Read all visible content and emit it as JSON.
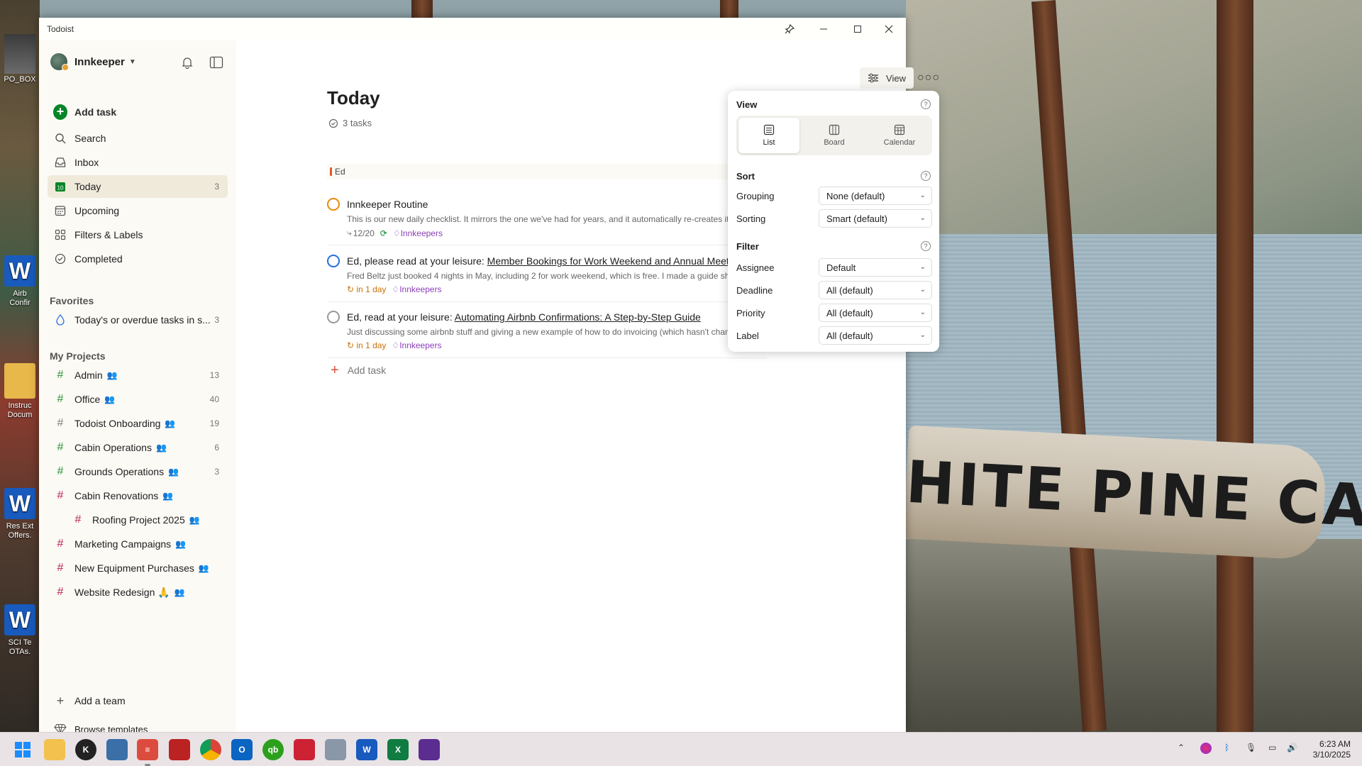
{
  "window": {
    "title": "Todoist"
  },
  "sidebar": {
    "account_name": "Innkeeper",
    "add_task": "Add task",
    "nav": [
      {
        "label": "Search",
        "icon": "search-icon"
      },
      {
        "label": "Inbox",
        "icon": "inbox-icon"
      },
      {
        "label": "Today",
        "icon": "calendar-today-icon",
        "count": "3"
      },
      {
        "label": "Upcoming",
        "icon": "calendar-upcoming-icon"
      },
      {
        "label": "Filters & Labels",
        "icon": "grid-icon"
      },
      {
        "label": "Completed",
        "icon": "check-circle-icon"
      }
    ],
    "favorites_heading": "Favorites",
    "favorites": [
      {
        "label": "Today's or overdue tasks in s...",
        "count": "3"
      }
    ],
    "projects_heading": "My Projects",
    "projects": [
      {
        "label": "Admin",
        "count": "13",
        "color": "#299438"
      },
      {
        "label": "Office",
        "count": "40",
        "color": "#299438"
      },
      {
        "label": "Todoist Onboarding",
        "count": "19",
        "color": "#808080"
      },
      {
        "label": "Cabin Operations",
        "count": "6",
        "color": "#299438"
      },
      {
        "label": "Grounds Operations",
        "count": "3",
        "color": "#299438"
      },
      {
        "label": "Cabin Renovations",
        "count": "",
        "color": "#b8255f"
      },
      {
        "label": "Roofing Project 2025",
        "count": "",
        "color": "#b8255f"
      },
      {
        "label": "Marketing Campaigns",
        "count": "",
        "color": "#b8255f"
      },
      {
        "label": "New Equipment Purchases",
        "count": "",
        "color": "#b8255f"
      },
      {
        "label": "Website Redesign 🙏",
        "count": "",
        "color": "#b8255f"
      }
    ],
    "add_team": "Add a team",
    "browse_templates": "Browse templates"
  },
  "main": {
    "title": "Today",
    "task_count": "3 tasks",
    "section": "Ed",
    "tasks": [
      {
        "title": "Innkeeper Routine",
        "title_link": "",
        "description": "This is our new daily checklist. It mirrors the one we've had for years, and it automatically re-creates its",
        "subtasks": "12/20",
        "due": "",
        "label": "Innkeepers",
        "circle_color": "#eb8909"
      },
      {
        "title": "Ed, please read at your leisure: ",
        "title_link": "Member Bookings for Work Weekend and Annual Meeti",
        "description": "Fred Beltz just booked 4 nights in May, including 2 for work weekend, which is free. I made a guide sh",
        "subtasks": "",
        "due": "in 1 day",
        "label": "Innkeepers",
        "circle_color": "#246fe0"
      },
      {
        "title": "Ed, read at your leisure: ",
        "title_link": "Automating Airbnb Confirmations: A Step-by-Step Guide",
        "description": "Just discussing some airbnb stuff and giving a new example of how to do invoicing (which hasn't chan",
        "subtasks": "",
        "due": "in 1 day",
        "label": "Innkeepers",
        "circle_color": "#999999"
      }
    ],
    "add_task": "Add task",
    "view_button": "View"
  },
  "view_popover": {
    "view_heading": "View",
    "layouts": [
      {
        "label": "List",
        "selected": true
      },
      {
        "label": "Board",
        "selected": false
      },
      {
        "label": "Calendar",
        "selected": false
      }
    ],
    "sort_heading": "Sort",
    "sort": [
      {
        "label": "Grouping",
        "value": "None (default)"
      },
      {
        "label": "Sorting",
        "value": "Smart (default)"
      }
    ],
    "filter_heading": "Filter",
    "filter": [
      {
        "label": "Assignee",
        "value": "Default"
      },
      {
        "label": "Deadline",
        "value": "All (default)"
      },
      {
        "label": "Priority",
        "value": "All (default)"
      },
      {
        "label": "Label",
        "value": "All (default)"
      }
    ]
  },
  "desktop": {
    "sign_text": "HITE PINE CAMP",
    "icons": [
      {
        "label": "PO_BOX"
      },
      {
        "label": "Airb Confir"
      },
      {
        "label": "Instruc Docum"
      },
      {
        "label": "Res Ext Offers."
      },
      {
        "label": "SCI Te OTAs."
      }
    ]
  },
  "taskbar": {
    "time": "6:23 AM",
    "date": "3/10/2025",
    "apps": [
      "start",
      "file-explorer",
      "app-k",
      "app-grid",
      "todoist",
      "app-red",
      "chrome",
      "outlook",
      "quickbooks",
      "app-snip",
      "app-printer",
      "word",
      "excel",
      "app-purple"
    ]
  },
  "accent": "#dc4c3e"
}
